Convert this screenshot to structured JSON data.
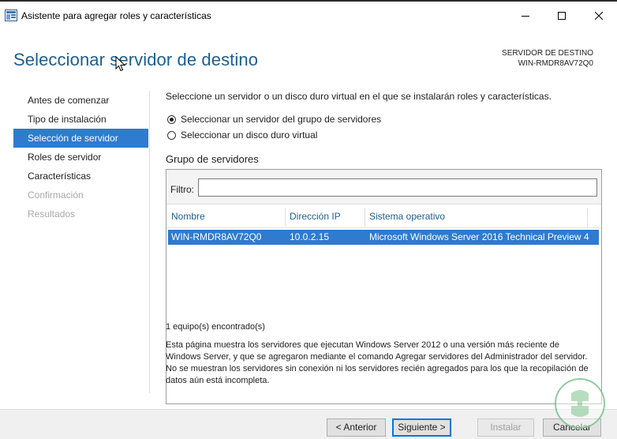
{
  "window": {
    "title": "Asistente para agregar roles y características"
  },
  "header": {
    "page_title": "Seleccionar servidor de destino",
    "destination_caption": "SERVIDOR DE DESTINO",
    "destination_server": "WIN-RMDR8AV72Q0"
  },
  "sidebar": {
    "items": [
      {
        "label": "Antes de comenzar",
        "state": "normal"
      },
      {
        "label": "Tipo de instalación",
        "state": "normal"
      },
      {
        "label": "Selección de servidor",
        "state": "active"
      },
      {
        "label": "Roles de servidor",
        "state": "normal"
      },
      {
        "label": "Características",
        "state": "normal"
      },
      {
        "label": "Confirmación",
        "state": "disabled"
      },
      {
        "label": "Resultados",
        "state": "disabled"
      }
    ]
  },
  "main": {
    "intro": "Seleccione un servidor o un disco duro virtual en el que se instalarán roles y características.",
    "radio_options": [
      {
        "label": "Seleccionar un servidor del grupo de servidores",
        "selected": true
      },
      {
        "label": "Seleccionar un disco duro virtual",
        "selected": false
      }
    ],
    "group_label": "Grupo de servidores",
    "filter_label": "Filtro:",
    "filter_value": "",
    "columns": [
      "Nombre",
      "Dirección IP",
      "Sistema operativo"
    ],
    "rows": [
      {
        "name": "WIN-RMDR8AV72Q0",
        "ip": "10.0.2.15",
        "os": "Microsoft Windows Server 2016 Technical Preview 4",
        "selected": true
      }
    ],
    "found_text": "1 equipo(s) encontrado(s)",
    "description": "Esta página muestra los servidores que ejecutan Windows Server 2012 o una versión más reciente de Windows Server, y que se agregaron mediante el comando Agregar servidores del Administrador del servidor. No se muestran los servidores sin conexión ni los servidores recién agregados para los que la recopilación de datos aún está incompleta."
  },
  "footer": {
    "back_label": "< Anterior",
    "next_label": "Siguiente >",
    "install_label": "Instalar",
    "cancel_label": "Cancelar"
  },
  "colors": {
    "accent": "#2e7bcf",
    "title_blue": "#1c5f8e",
    "disabled_text": "#a8a8a8"
  }
}
